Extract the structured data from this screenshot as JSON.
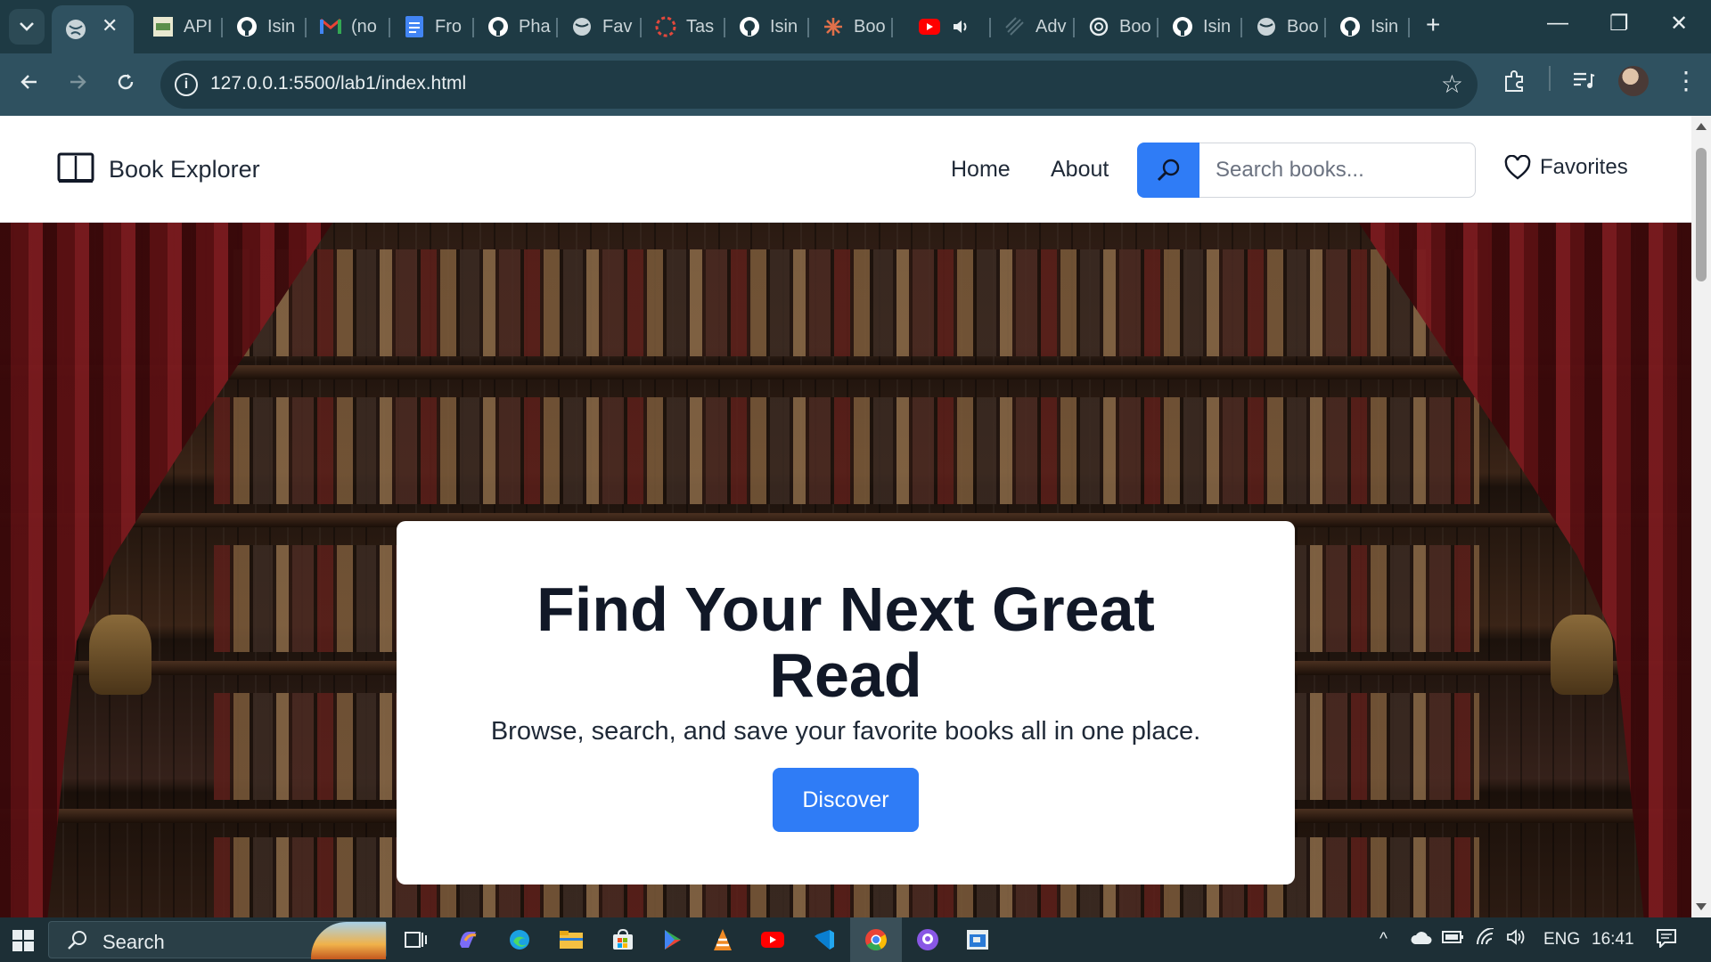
{
  "browser": {
    "tabs": [
      {
        "label": "API",
        "icon": "openapi-favicon"
      },
      {
        "label": "Isin",
        "icon": "github-favicon"
      },
      {
        "label": "(no",
        "icon": "gmail-favicon"
      },
      {
        "label": "Fro",
        "icon": "docs-favicon"
      },
      {
        "label": "Pha",
        "icon": "github-favicon"
      },
      {
        "label": "Fav",
        "icon": "globe-favicon"
      },
      {
        "label": "Tas",
        "icon": "task-favicon"
      },
      {
        "label": "Isin",
        "icon": "github-favicon"
      },
      {
        "label": "Boo",
        "icon": "claude-favicon"
      },
      {
        "label": "",
        "icon": "youtube-favicon"
      },
      {
        "label": "Adv",
        "icon": "advanced-favicon"
      },
      {
        "label": "Boo",
        "icon": "openai-favicon"
      },
      {
        "label": "Isin",
        "icon": "github-favicon"
      },
      {
        "label": "Boo",
        "icon": "globe-favicon"
      },
      {
        "label": "Isin",
        "icon": "github-favicon"
      }
    ],
    "url": "127.0.0.1:5500/lab1/index.html"
  },
  "site": {
    "brand": "Book Explorer",
    "nav": {
      "home": "Home",
      "about": "About",
      "favorites": "Favorites"
    },
    "search_placeholder": "Search books...",
    "accent_color": "#2f7cf6"
  },
  "hero": {
    "title": "Find Your Next Great Read",
    "subtitle": "Browse, search, and save your favorite books all in one place.",
    "cta": "Discover"
  },
  "taskbar": {
    "search_label": "Search",
    "language": "ENG",
    "time": "16:41"
  }
}
